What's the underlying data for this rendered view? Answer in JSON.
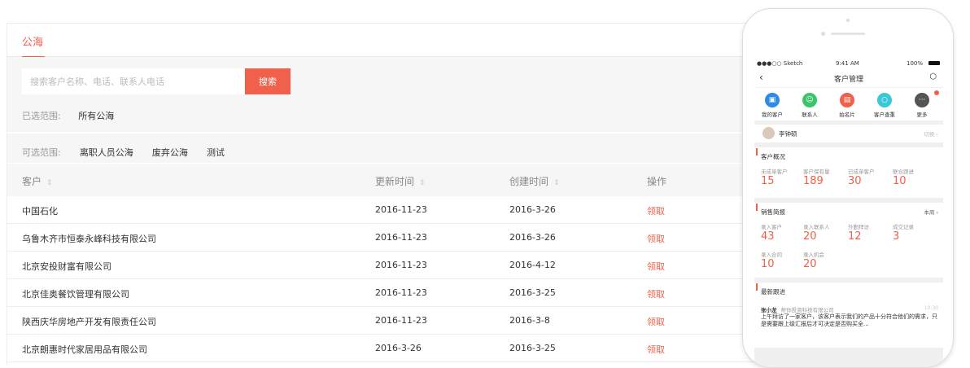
{
  "tab": {
    "label": "公海"
  },
  "search": {
    "placeholder": "搜索客户名称、电话、联系人电话",
    "button": "搜索"
  },
  "selected": {
    "label": "已选范围:",
    "value": "所有公海"
  },
  "filters": {
    "label": "可选范围:",
    "options": [
      "离职人员公海",
      "废弃公海",
      "测试"
    ]
  },
  "table": {
    "headers": {
      "customer": "客户",
      "updated": "更新时间",
      "created": "创建时间",
      "action": "操作"
    },
    "sort_icon": "⇕",
    "rows": [
      {
        "name": "中国石化",
        "updated": "2016-11-23",
        "created": "2016-3-26",
        "action": "领取"
      },
      {
        "name": "乌鲁木齐市恒泰永峰科技有限公司",
        "updated": "2016-11-23",
        "created": "2016-3-26",
        "action": "领取"
      },
      {
        "name": "北京安投财富有限公司",
        "updated": "2016-11-23",
        "created": "2016-4-12",
        "action": "领取"
      },
      {
        "name": "北京佳奥餐饮管理有限公司",
        "updated": "2016-11-23",
        "created": "2016-3-25",
        "action": "领取"
      },
      {
        "name": "陕西庆华房地产开发有限责任公司",
        "updated": "2016-11-23",
        "created": "2016-3-8",
        "action": "领取"
      },
      {
        "name": "北京朗惠时代家居用品有限公司",
        "updated": "2016-3-26",
        "created": "2016-3-25",
        "action": "领取"
      }
    ]
  },
  "phone": {
    "status": {
      "carrier": "●●●○○ Sketch",
      "time": "9:41 AM",
      "battery": "100%"
    },
    "title": "客户管理",
    "quick": [
      {
        "label": "我的客户",
        "color": "#2b8be6",
        "icon": "user-card-icon"
      },
      {
        "label": "联系人",
        "color": "#3cc46b",
        "icon": "contact-icon"
      },
      {
        "label": "拍名片",
        "color": "#f0604a",
        "icon": "card-scan-icon"
      },
      {
        "label": "客户查重",
        "color": "#38c8d8",
        "icon": "search-icon"
      },
      {
        "label": "更多",
        "color": "#555555",
        "icon": "more-icon"
      }
    ],
    "user": {
      "name": "李钟硕",
      "switch": "切换"
    },
    "overview": {
      "title": "客户概况",
      "stats": [
        {
          "k": "未成单客户",
          "v": "15"
        },
        {
          "k": "客户保有量",
          "v": "189"
        },
        {
          "k": "已成单客户",
          "v": "30"
        },
        {
          "k": "联合跟进",
          "v": "10"
        }
      ]
    },
    "sales": {
      "title": "销售简报",
      "period": "本周",
      "stats": [
        {
          "k": "录入客户",
          "v": "43"
        },
        {
          "k": "录入联系人",
          "v": "20"
        },
        {
          "k": "外勤拜访",
          "v": "12"
        },
        {
          "k": "成交记录",
          "v": "3"
        },
        {
          "k": "录入合同",
          "v": "10"
        },
        {
          "k": "录入机会",
          "v": "20"
        }
      ]
    },
    "followup": {
      "title": "最新跟进",
      "author": "张小龙",
      "company": "帮你投资科技有限公司",
      "time": "10:30",
      "text": "上午拜访了一家客户，该客户表示我们的产品十分符合他们的需求，只是需要跟上级汇报后才可决定是否购买全..."
    }
  }
}
